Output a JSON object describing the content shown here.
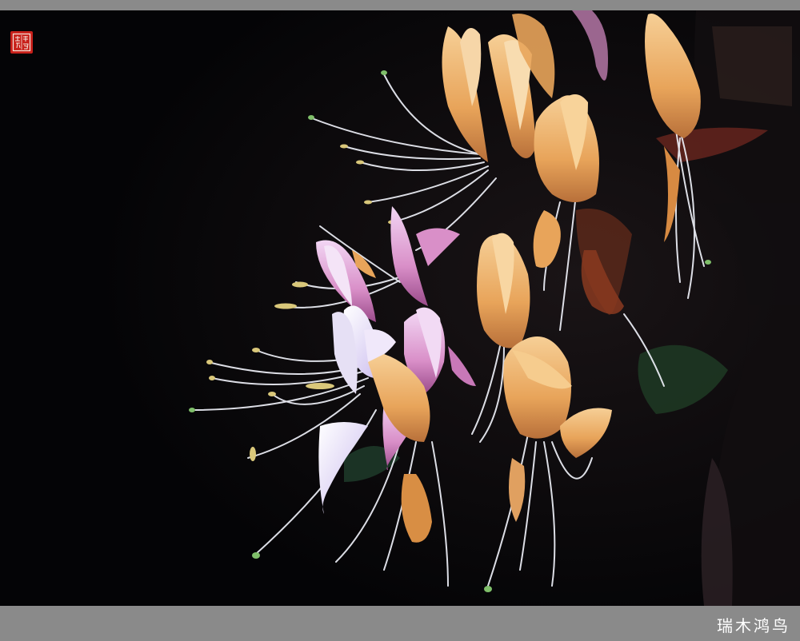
{
  "photo": {
    "subject": "honeysuckle-flowers",
    "colors": {
      "background": "#050507",
      "frame": "#8a8a8a",
      "petal_orange": "#e8a45a",
      "petal_pink": "#d98fc8",
      "petal_white": "#e6e0f5",
      "stamen": "#eef0f8",
      "anther": "#d9c77a",
      "leaf": "#1f3b2a",
      "seal": "#c8201a"
    }
  },
  "seal": {
    "text": "瑞木鸿鸟"
  },
  "footer": {
    "signature": "瑞木鸿鸟"
  }
}
